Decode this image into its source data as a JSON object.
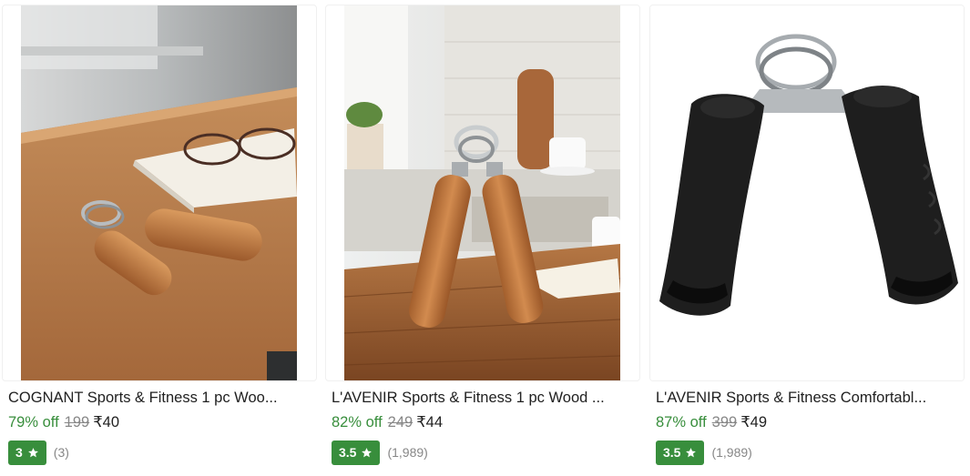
{
  "products": [
    {
      "title": "COGNANT Sports & Fitness 1 pc Woo...",
      "discount": "79% off",
      "mrp": "199",
      "price": "₹40",
      "rating": "3",
      "rating_count": "(3)",
      "image_icon": "wooden-hand-gripper-photo"
    },
    {
      "title": "L'AVENIR Sports & Fitness 1 pc Wood ...",
      "discount": "82% off",
      "mrp": "249",
      "price": "₹44",
      "rating": "3.5",
      "rating_count": "(1,989)",
      "image_icon": "wooden-hand-gripper-standing-photo"
    },
    {
      "title": "L'AVENIR Sports & Fitness Comfortabl...",
      "discount": "87% off",
      "mrp": "399",
      "price": "₹49",
      "rating": "3.5",
      "rating_count": "(1,989)",
      "image_icon": "black-hand-gripper-photo"
    }
  ],
  "colors": {
    "discount_green": "#388e3c",
    "rating_badge": "#388e3c",
    "muted_text": "#878787"
  }
}
